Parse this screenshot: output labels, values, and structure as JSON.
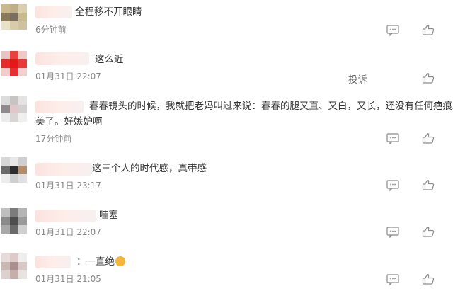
{
  "comments": [
    {
      "text": "全程移不开眼睛",
      "text2": "",
      "time": "6分钟前",
      "emoji": false,
      "avatar": [
        "#cbb98e",
        "#bfae86",
        "#d9cfaf",
        "#8a7a5a",
        "#7a6f5f",
        "#c8b98f",
        "#e8e2c9",
        "#d8cba7",
        "#cfc2a0"
      ]
    },
    {
      "text": "这么近",
      "text2": "",
      "time": "01月31日 22:07",
      "emoji": false,
      "avatar": [
        "#e8c4c4",
        "#e94040",
        "#f0c8c8",
        "#e62a2a",
        "#e01919",
        "#e83838",
        "#f2cccc",
        "#e43030",
        "#f3d0d0"
      ]
    },
    {
      "text": "春春镜头的时候，我就把老妈叫过来说：春春的腿又直、又白，又长，还没有任何疤痕。很",
      "text2": "美了。好嫉妒啊",
      "time": "17分钟前",
      "emoji": false,
      "avatar": [
        "#dcdcdc",
        "#c8c4c4",
        "#e4e2e2",
        "#8e8a8e",
        "#e0c7c9",
        "#d2d0d0",
        "#ececec",
        "#d9d5d5",
        "#efefef"
      ]
    },
    {
      "text": "这三个人的时代感，真带感",
      "text2": "",
      "time": "01月31日 23:17",
      "emoji": false,
      "avatar": [
        "#d7d7d7",
        "#e8e8e8",
        "#cfcfcf",
        "#6b6b6b",
        "#2f2f2f",
        "#b48d6c",
        "#ededed",
        "#cfcfcf",
        "#e0e0e0"
      ]
    },
    {
      "text": "哇塞",
      "text2": "",
      "time": "01月31日 22:07",
      "emoji": false,
      "avatar": [
        "#bfbfbf",
        "#7c7c7c",
        "#b5b5b5",
        "#8a8a8a",
        "#4e4e4e",
        "#9a9a9a",
        "#a8a8a8",
        "#6a6a6a",
        "#cfcfcf"
      ]
    },
    {
      "text": "一直绝",
      "text2": "",
      "time": "01月31日 21:05",
      "emoji": true,
      "avatar": [
        "#e6dada",
        "#dccbc8",
        "#eeeeee",
        "#cbb8b5",
        "#a9908e",
        "#d8c9c7",
        "#ddd1cf",
        "#c4afab",
        "#e8e2e1"
      ]
    }
  ],
  "report_label": "投诉",
  "icons": {
    "reply": "reply-icon",
    "like": "like-icon",
    "emoji": "clap-emoji-icon"
  }
}
